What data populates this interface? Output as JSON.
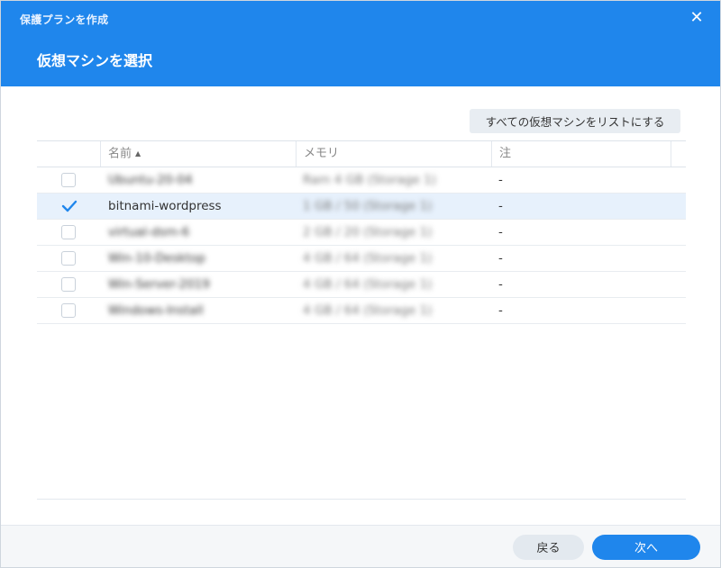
{
  "dialog": {
    "window_title": "保護プランを作成",
    "step_title": "仮想マシンを選択",
    "close_glyph": "✕"
  },
  "toolbar": {
    "list_all_vms_label": "すべての仮想マシンをリストにする"
  },
  "grid": {
    "columns": {
      "name": "名前",
      "memory": "メモリ",
      "note": "注"
    },
    "sort_indicator": "▲",
    "rows": [
      {
        "name": "Ubuntu-20-04",
        "memory": "Ram 4 GB (Storage 1)",
        "note": "-",
        "checked": false,
        "blurred": true
      },
      {
        "name": "bitnami-wordpress",
        "memory": "1 GB / 50 (Storage 1)",
        "note": "-",
        "checked": true,
        "blurred": false
      },
      {
        "name": "virtual-dsm-6",
        "memory": "2 GB / 20 (Storage 1)",
        "note": "-",
        "checked": false,
        "blurred": true
      },
      {
        "name": "Win-10-Desktop",
        "memory": "4 GB / 64 (Storage 1)",
        "note": "-",
        "checked": false,
        "blurred": true
      },
      {
        "name": "Win-Server-2019",
        "memory": "4 GB / 64 (Storage 1)",
        "note": "-",
        "checked": false,
        "blurred": true
      },
      {
        "name": "Windows-Install",
        "memory": "4 GB / 64 (Storage 1)",
        "note": "-",
        "checked": false,
        "blurred": true
      }
    ]
  },
  "footer": {
    "back_label": "戻る",
    "next_label": "次へ"
  },
  "colors": {
    "accent": "#1f86ec",
    "selected_row": "#e7f1fc"
  }
}
